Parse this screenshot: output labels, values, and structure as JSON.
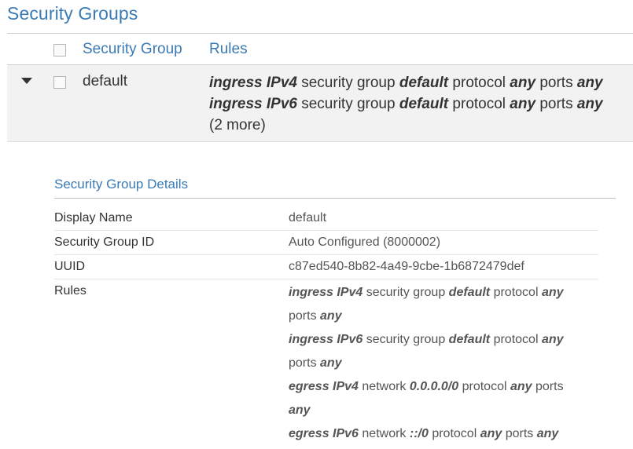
{
  "page": {
    "title": "Security Groups"
  },
  "table": {
    "headers": {
      "security_group": "Security Group",
      "rules": "Rules"
    },
    "rows": [
      {
        "name": "default",
        "rules": [
          {
            "direction": "ingress IPv4",
            "t1": " security group ",
            "target": "default",
            "t2": " protocol ",
            "protocol": "any",
            "t3": " ports ",
            "ports": "any"
          },
          {
            "direction": "ingress IPv6",
            "t1": " security group ",
            "target": "default",
            "t2": " protocol ",
            "protocol": "any",
            "t3": " ports ",
            "ports": "any"
          }
        ],
        "more": "(2 more)"
      }
    ]
  },
  "details": {
    "title": "Security Group Details",
    "fields": [
      {
        "label": "Display Name",
        "value": "default"
      },
      {
        "label": "Security Group ID",
        "value": "Auto Configured (8000002)"
      },
      {
        "label": "UUID",
        "value": "c87ed540-8b82-4a49-9cbe-1b6872479def"
      }
    ],
    "rules_label": "Rules",
    "rules": [
      {
        "direction": "ingress IPv4",
        "t1": " security group ",
        "target": "default",
        "t2": " protocol ",
        "protocol": "any",
        "t3": " ports ",
        "ports": "any"
      },
      {
        "direction": "ingress IPv6",
        "t1": " security group ",
        "target": "default",
        "t2": " protocol ",
        "protocol": "any",
        "t3": " ports ",
        "ports": "any"
      },
      {
        "direction": "egress IPv4",
        "t1": " network ",
        "target": "0.0.0.0/0",
        "t2": " protocol ",
        "protocol": "any",
        "t3": " ports ",
        "ports": "any"
      },
      {
        "direction": "egress IPv6",
        "t1": " network ",
        "target": "::/0",
        "t2": " protocol ",
        "protocol": "any",
        "t3": " ports ",
        "ports": "any"
      }
    ]
  },
  "colors": {
    "accent": "#3a7ab5",
    "row_bg": "#f2f2f2"
  }
}
